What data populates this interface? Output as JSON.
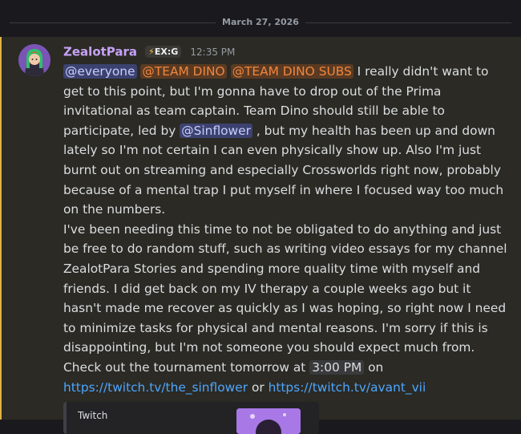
{
  "date_divider": "March 27, 2026",
  "message": {
    "username": "ZealotPara",
    "tag": {
      "icon": "bolt-icon",
      "label": "EX:G"
    },
    "timestamp": "12:35 PM",
    "mentions": {
      "everyone": "@everyone",
      "team_dino": "@TEAM DINO",
      "team_dino_subs": "@TEAM DINO SUBS",
      "sinflower": "@Sinflower"
    },
    "text": {
      "p1a": " I really didn't want to get to this point, but I'm gonna have to drop out of the Prima invitational as team captain. Team Dino should still be able to participate, led by ",
      "p1b": " , but my health has been up and down lately so I'm not certain I can even physically show up. Also I'm just burnt out on streaming and especially Crossworlds right now, probably because of a mental trap I put myself in where I focused way too much on the numbers.",
      "p2": "I've been needing this time to not be obligated to do anything and just be free to do random stuff, such as writing video essays for my channel ZealotPara Stories and spending more quality time with myself and friends. I did get back on my IV therapy a couple weeks ago but it hasn't made me recover as quickly as I was hoping, so right now I need to minimize tasks for physical and mental reasons. I'm sorry if this is disappointing, but I'm not someone you should expect much from.",
      "p3a": "Check out the tournament tomorrow at ",
      "time": "3:00 PM",
      "p3b": " on",
      "link1": "https://twitch.tv/the_sinflower",
      "or": " or ",
      "link2": "https://twitch.tv/avant_vii"
    },
    "embed": {
      "provider": "Twitch"
    }
  },
  "colors": {
    "accent_border": "#e0b144",
    "username": "#c7a2f7",
    "mention": "#c9cdfb",
    "role_mention": "#f0863e",
    "link": "#4da6ff"
  }
}
